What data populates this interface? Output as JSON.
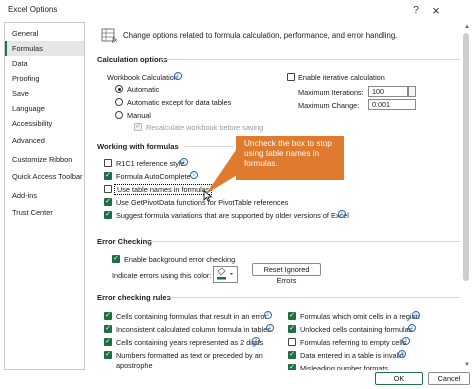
{
  "window": {
    "title": "Excel Options",
    "help": "?",
    "close": "×"
  },
  "nav": {
    "items": [
      {
        "label": "General"
      },
      {
        "label": "Formulas"
      },
      {
        "label": "Data"
      },
      {
        "label": "Proofing"
      },
      {
        "label": "Save"
      },
      {
        "label": "Language"
      },
      {
        "label": "Accessibility"
      },
      {
        "label": "Advanced"
      },
      {
        "label": "Customize Ribbon"
      },
      {
        "label": "Quick Access Toolbar"
      },
      {
        "label": "Add-ins"
      },
      {
        "label": "Trust Center"
      }
    ],
    "selected": "Formulas"
  },
  "header": {
    "text": "Change options related to formula calculation, performance, and error handling."
  },
  "calc": {
    "title": "Calculation options",
    "workbook_label": "Workbook Calculation",
    "automatic": "Automatic",
    "automatic_except": "Automatic except for data tables",
    "manual": "Manual",
    "recalc": "Recalculate workbook before saving",
    "iterative": "Enable iterative calculation",
    "max_iter_label": "Maximum Iterations:",
    "max_iter_value": "100",
    "max_change_label": "Maximum Change:",
    "max_change_value": "0.001"
  },
  "working": {
    "title": "Working with formulas",
    "r1c1": "R1C1 reference style",
    "autocomplete": "Formula AutoComplete",
    "table_names": "Use table names in formulas",
    "getpivot": "Use GetPivotData functions for PivotTable references",
    "suggest": "Suggest formula variations that are supported by older versions of Excel"
  },
  "callout": {
    "text": "Uncheck the box to stop using table names in formulas."
  },
  "error_checking": {
    "title": "Error Checking",
    "enable_bg": "Enable background error checking",
    "color_label": "Indicate errors using this color:",
    "reset_button": "Reset Ignored Errors"
  },
  "rules": {
    "title": "Error checking rules",
    "left": [
      "Cells containing formulas that result in an error",
      "Inconsistent calculated column formula in tables",
      "Cells containing years represented as 2 digits",
      "Numbers formatted as text or preceded by an",
      "apostrophe"
    ],
    "right": [
      "Formulas which omit cells in a region",
      "Unlocked cells containing formulas",
      "Formulas referring to empty cells",
      "Data entered in a table is invalid",
      "Misleading number formats"
    ]
  },
  "footer": {
    "ok": "OK",
    "cancel": "Cancel"
  },
  "colors": {
    "accent": "#217346",
    "callout": "#e07a2e",
    "check": "#1f6e43"
  },
  "icons": {
    "info": "i",
    "check": "✓",
    "up": "▲",
    "down": "▼"
  }
}
